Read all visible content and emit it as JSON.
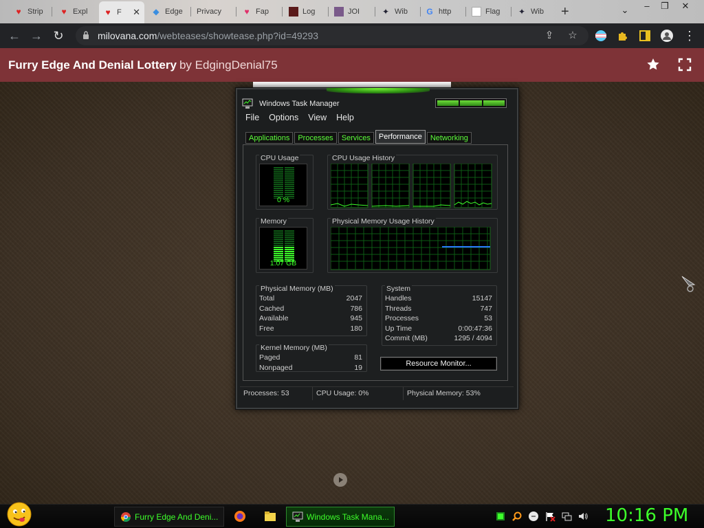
{
  "browser": {
    "tabs": [
      {
        "label": "Strip"
      },
      {
        "label": "Expl"
      },
      {
        "label": "F"
      },
      {
        "label": "Edge"
      },
      {
        "label": "Privacy"
      },
      {
        "label": "Fap"
      },
      {
        "label": "Log"
      },
      {
        "label": "JOI"
      },
      {
        "label": "Wib"
      },
      {
        "label": "http"
      },
      {
        "label": "Flag"
      },
      {
        "label": "Wib"
      }
    ],
    "url_domain": "milovana.com",
    "url_path": "/webteases/showtease.php?id=49293"
  },
  "site": {
    "title": "Furry Edge And Denial Lottery",
    "author": "by EdgingDenial75"
  },
  "taskmanager": {
    "title": "Windows Task Manager",
    "menu": [
      "File",
      "Options",
      "View",
      "Help"
    ],
    "tabs": [
      "Applications",
      "Processes",
      "Services",
      "Performance",
      "Networking"
    ],
    "active_tab": "Performance",
    "cpu_usage_label": "CPU Usage",
    "cpu_usage_value": "0 %",
    "cpu_usage_fraction": 0.0,
    "cpu_history_label": "CPU Usage History",
    "memory_label": "Memory",
    "memory_value": "1.07 GB",
    "memory_fraction": 0.53,
    "mem_history_label": "Physical Memory Usage History",
    "physical_memory": {
      "label": "Physical Memory (MB)",
      "rows": [
        {
          "k": "Total",
          "v": "2047"
        },
        {
          "k": "Cached",
          "v": "786"
        },
        {
          "k": "Available",
          "v": "945"
        },
        {
          "k": "Free",
          "v": "180"
        }
      ]
    },
    "kernel_memory": {
      "label": "Kernel Memory (MB)",
      "rows": [
        {
          "k": "Paged",
          "v": "81"
        },
        {
          "k": "Nonpaged",
          "v": "19"
        }
      ]
    },
    "system": {
      "label": "System",
      "rows": [
        {
          "k": "Handles",
          "v": "15147"
        },
        {
          "k": "Threads",
          "v": "747"
        },
        {
          "k": "Processes",
          "v": "53"
        },
        {
          "k": "Up Time",
          "v": "0:00:47:36"
        },
        {
          "k": "Commit (MB)",
          "v": "1295 / 4094"
        }
      ]
    },
    "resource_monitor_button": "Resource Monitor...",
    "status": {
      "processes": "Processes: 53",
      "cpu": "CPU Usage: 0%",
      "memory": "Physical Memory: 53%"
    }
  },
  "taskbar": {
    "buttons": [
      {
        "label": "Furry Edge And Deni..."
      },
      {
        "label": "Windows Task Mana..."
      }
    ],
    "clock": "10:16 PM"
  },
  "colors": {
    "header_bg": "#7e3337",
    "accent_green": "#3dff2a",
    "toolbar_bg": "#222326"
  }
}
